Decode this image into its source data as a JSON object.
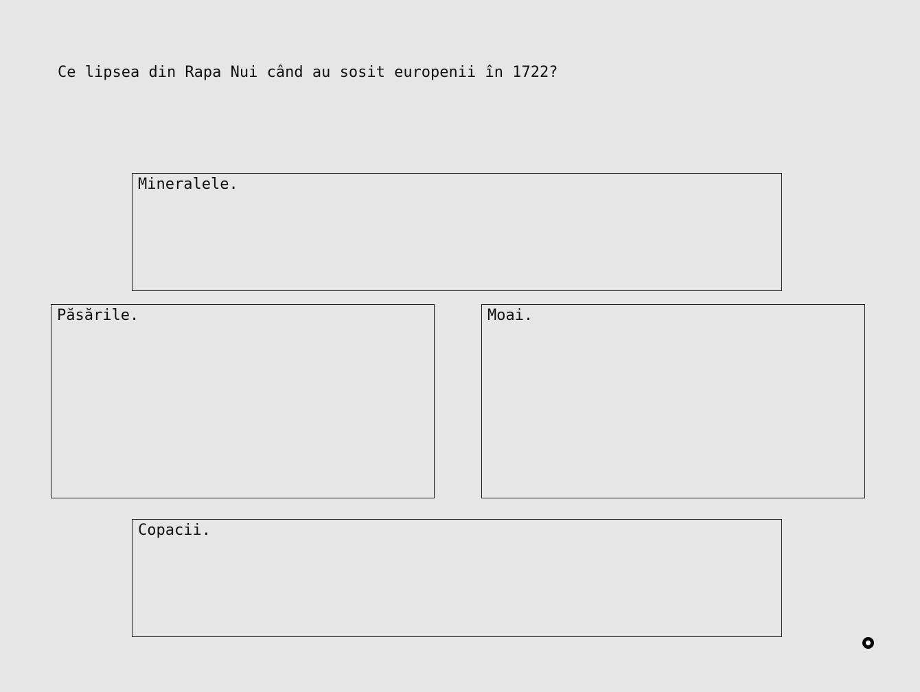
{
  "question": {
    "text": "Ce lipsea din Rapa Nui când au sosit europenii în 1722?"
  },
  "answers": [
    {
      "label": "Mineralele."
    },
    {
      "label": "Păsările."
    },
    {
      "label": "Moai."
    },
    {
      "label": "Copacii."
    }
  ],
  "cursor": {
    "icon": "ring-cursor-icon"
  },
  "colors": {
    "background": "#e6e6e6",
    "border": "#1a1a1a",
    "text": "#111111"
  }
}
